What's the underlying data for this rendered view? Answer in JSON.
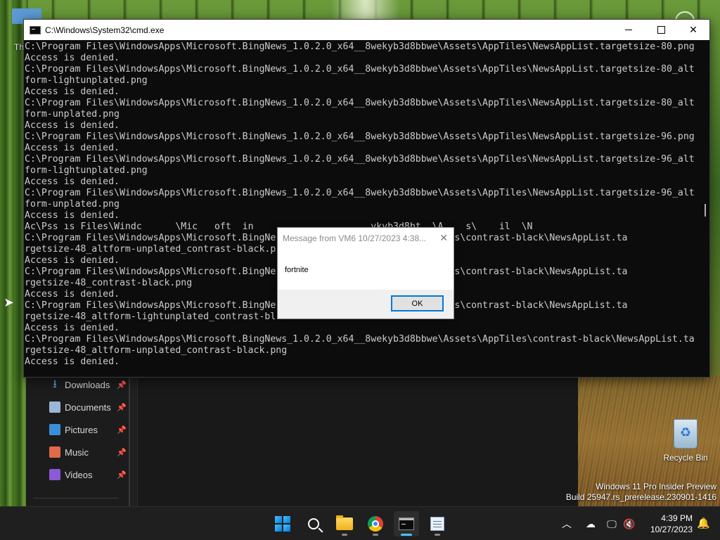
{
  "desktop": {
    "fragment_text": "Th",
    "recycle_bin_label": "Recycle Bin",
    "watermark": {
      "line1": "Windows 11 Pro Insider Preview",
      "line2": "Build 25947.rs_prerelease.230901-1416"
    }
  },
  "explorer": {
    "nav_items": [
      {
        "label": "Downloads",
        "icon": "downloads-icon"
      },
      {
        "label": "Documents",
        "icon": "documents-icon"
      },
      {
        "label": "Pictures",
        "icon": "pictures-icon"
      },
      {
        "label": "Music",
        "icon": "music-icon"
      },
      {
        "label": "Videos",
        "icon": "videos-icon"
      }
    ]
  },
  "cmd": {
    "title": "C:\\Windows\\System32\\cmd.exe",
    "lines": [
      "C:\\Program Files\\WindowsApps\\Microsoft.BingNews_1.0.2.0_x64__8wekyb3d8bbwe\\Assets\\AppTiles\\NewsAppList.targetsize-80.png",
      "Access is denied.",
      "C:\\Program Files\\WindowsApps\\Microsoft.BingNews_1.0.2.0_x64__8wekyb3d8bbwe\\Assets\\AppTiles\\NewsAppList.targetsize-80_alt",
      "form-lightunplated.png",
      "Access is denied.",
      "C:\\Program Files\\WindowsApps\\Microsoft.BingNews_1.0.2.0_x64__8wekyb3d8bbwe\\Assets\\AppTiles\\NewsAppList.targetsize-80_alt",
      "form-unplated.png",
      "Access is denied.",
      "C:\\Program Files\\WindowsApps\\Microsoft.BingNews_1.0.2.0_x64__8wekyb3d8bbwe\\Assets\\AppTiles\\NewsAppList.targetsize-96.png",
      "Access is denied.",
      "C:\\Program Files\\WindowsApps\\Microsoft.BingNews_1.0.2.0_x64__8wekyb3d8bbwe\\Assets\\AppTiles\\NewsAppList.targetsize-96_alt",
      "form-lightunplated.png",
      "Access is denied.",
      "C:\\Program Files\\WindowsApps\\Microsoft.BingNews_1.0.2.0_x64__8wekyb3d8bbwe\\Assets\\AppTiles\\NewsAppList.targetsize-96_alt",
      "form-unplated.png",
      "Access is denied.",
      "Ac\\Pss ıs Files\\Windc      \\Mic   oft  in                     ykyb3d8bt  \\A    s\\    il  \\N",
      "C:\\Program Files\\WindowsApps\\Microsoft.BingNe                  Assets\\AppTiles\\contrast-black\\NewsAppList.ta",
      "rgetsize-48_altform-unplated_contrast-black.p",
      "Access is denied.",
      "C:\\Program Files\\WindowsApps\\Microsoft.BingNe                  Assets\\AppTiles\\contrast-black\\NewsAppList.ta",
      "rgetsize-48_contrast-black.png",
      "Access is denied.",
      "C:\\Program Files\\WindowsApps\\Microsoft.BingNe                  Assets\\AppTiles\\contrast-black\\NewsAppList.ta",
      "rgetsize-48_altform-lightunplated_contrast-bl",
      "Access is denied.",
      "C:\\Program Files\\WindowsApps\\Microsoft.BingNews_1.0.2.0_x64__8wekyb3d8bbwe\\Assets\\AppTiles\\contrast-black\\NewsAppList.ta",
      "rgetsize-48_altform-unplated_contrast-black.png",
      "Access is denied."
    ]
  },
  "message_box": {
    "title": "Message from VM6 10/27/2023 4:38...",
    "message": "fortnite",
    "ok_label": "OK"
  },
  "taskbar": {
    "apps": [
      {
        "name": "start-button"
      },
      {
        "name": "search-button"
      },
      {
        "name": "file-explorer"
      },
      {
        "name": "chrome"
      },
      {
        "name": "command-prompt",
        "active": true
      },
      {
        "name": "notepad"
      }
    ],
    "clock": {
      "time": "4:39 PM",
      "date": "10/27/2023"
    }
  }
}
